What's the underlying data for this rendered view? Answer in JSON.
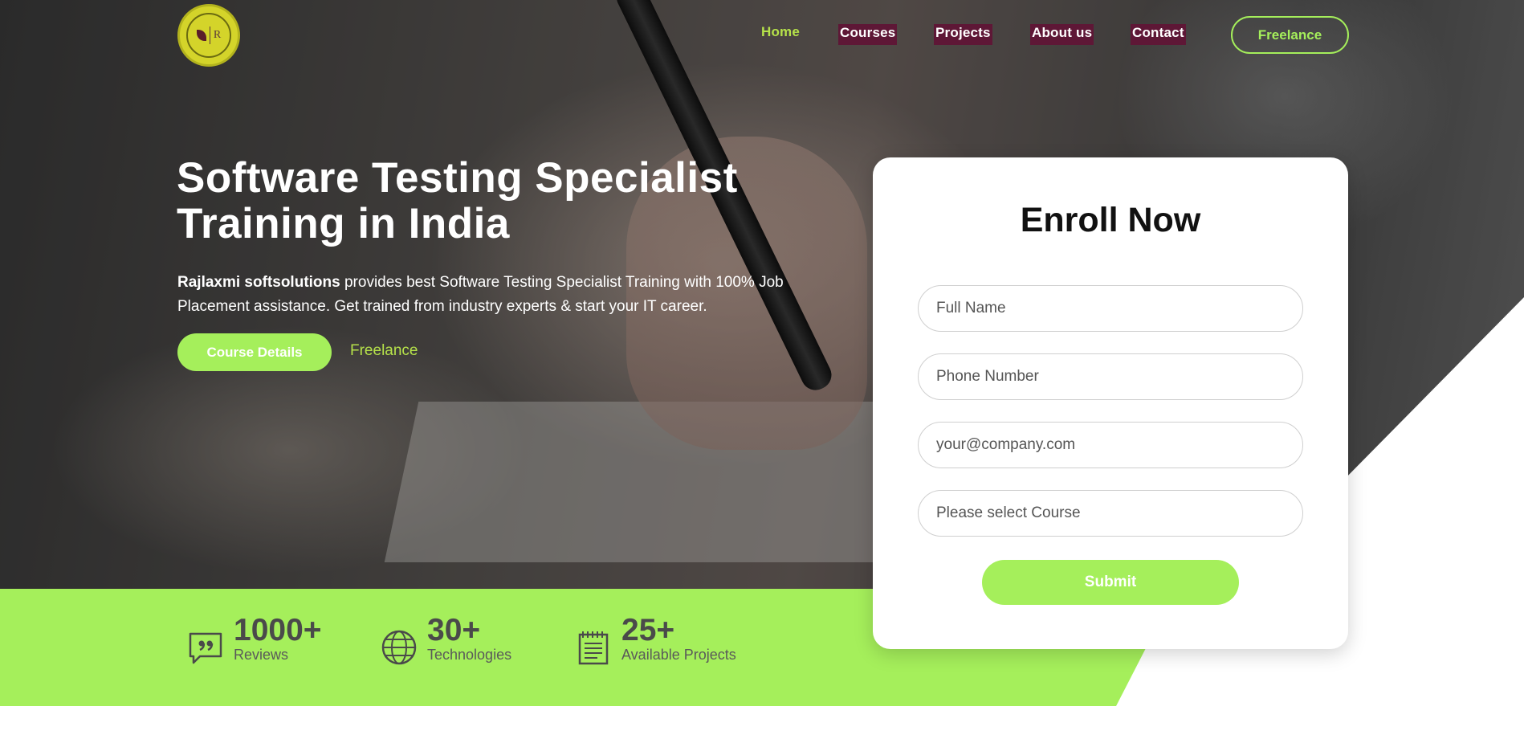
{
  "header": {
    "logo_letter": "R",
    "nav": [
      {
        "label": "Home"
      },
      {
        "label": "Courses"
      },
      {
        "label": "Projects"
      },
      {
        "label": "About us"
      },
      {
        "label": "Contact"
      }
    ],
    "cta_label": "Freelance"
  },
  "hero": {
    "title_line1": "Software Testing Specialist",
    "title_line2": "Training in India",
    "desc_brand": "Rajlaxmi softsolutions",
    "desc_rest": " provides best Software Testing Specialist Training with 100% Job Placement assistance. Get trained from industry experts & start your IT career.",
    "primary_button": "Course Details",
    "secondary_link": "Freelance"
  },
  "stats": [
    {
      "number": "1000+",
      "label": "Reviews",
      "icon": "chat-quote-icon"
    },
    {
      "number": "30+",
      "label": "Technologies",
      "icon": "globe-icon"
    },
    {
      "number": "25+",
      "label": "Available Projects",
      "icon": "notepad-icon"
    }
  ],
  "form": {
    "title": "Enroll Now",
    "name_placeholder": "Full Name",
    "phone_placeholder": "Phone Number",
    "email_placeholder": "your@company.com",
    "course_placeholder": "Please select Course",
    "submit_label": "Submit"
  },
  "colors": {
    "accent_green": "#a5ef5b",
    "nav_active": "#b6e24a",
    "nav_highlight": "#5e1736"
  }
}
